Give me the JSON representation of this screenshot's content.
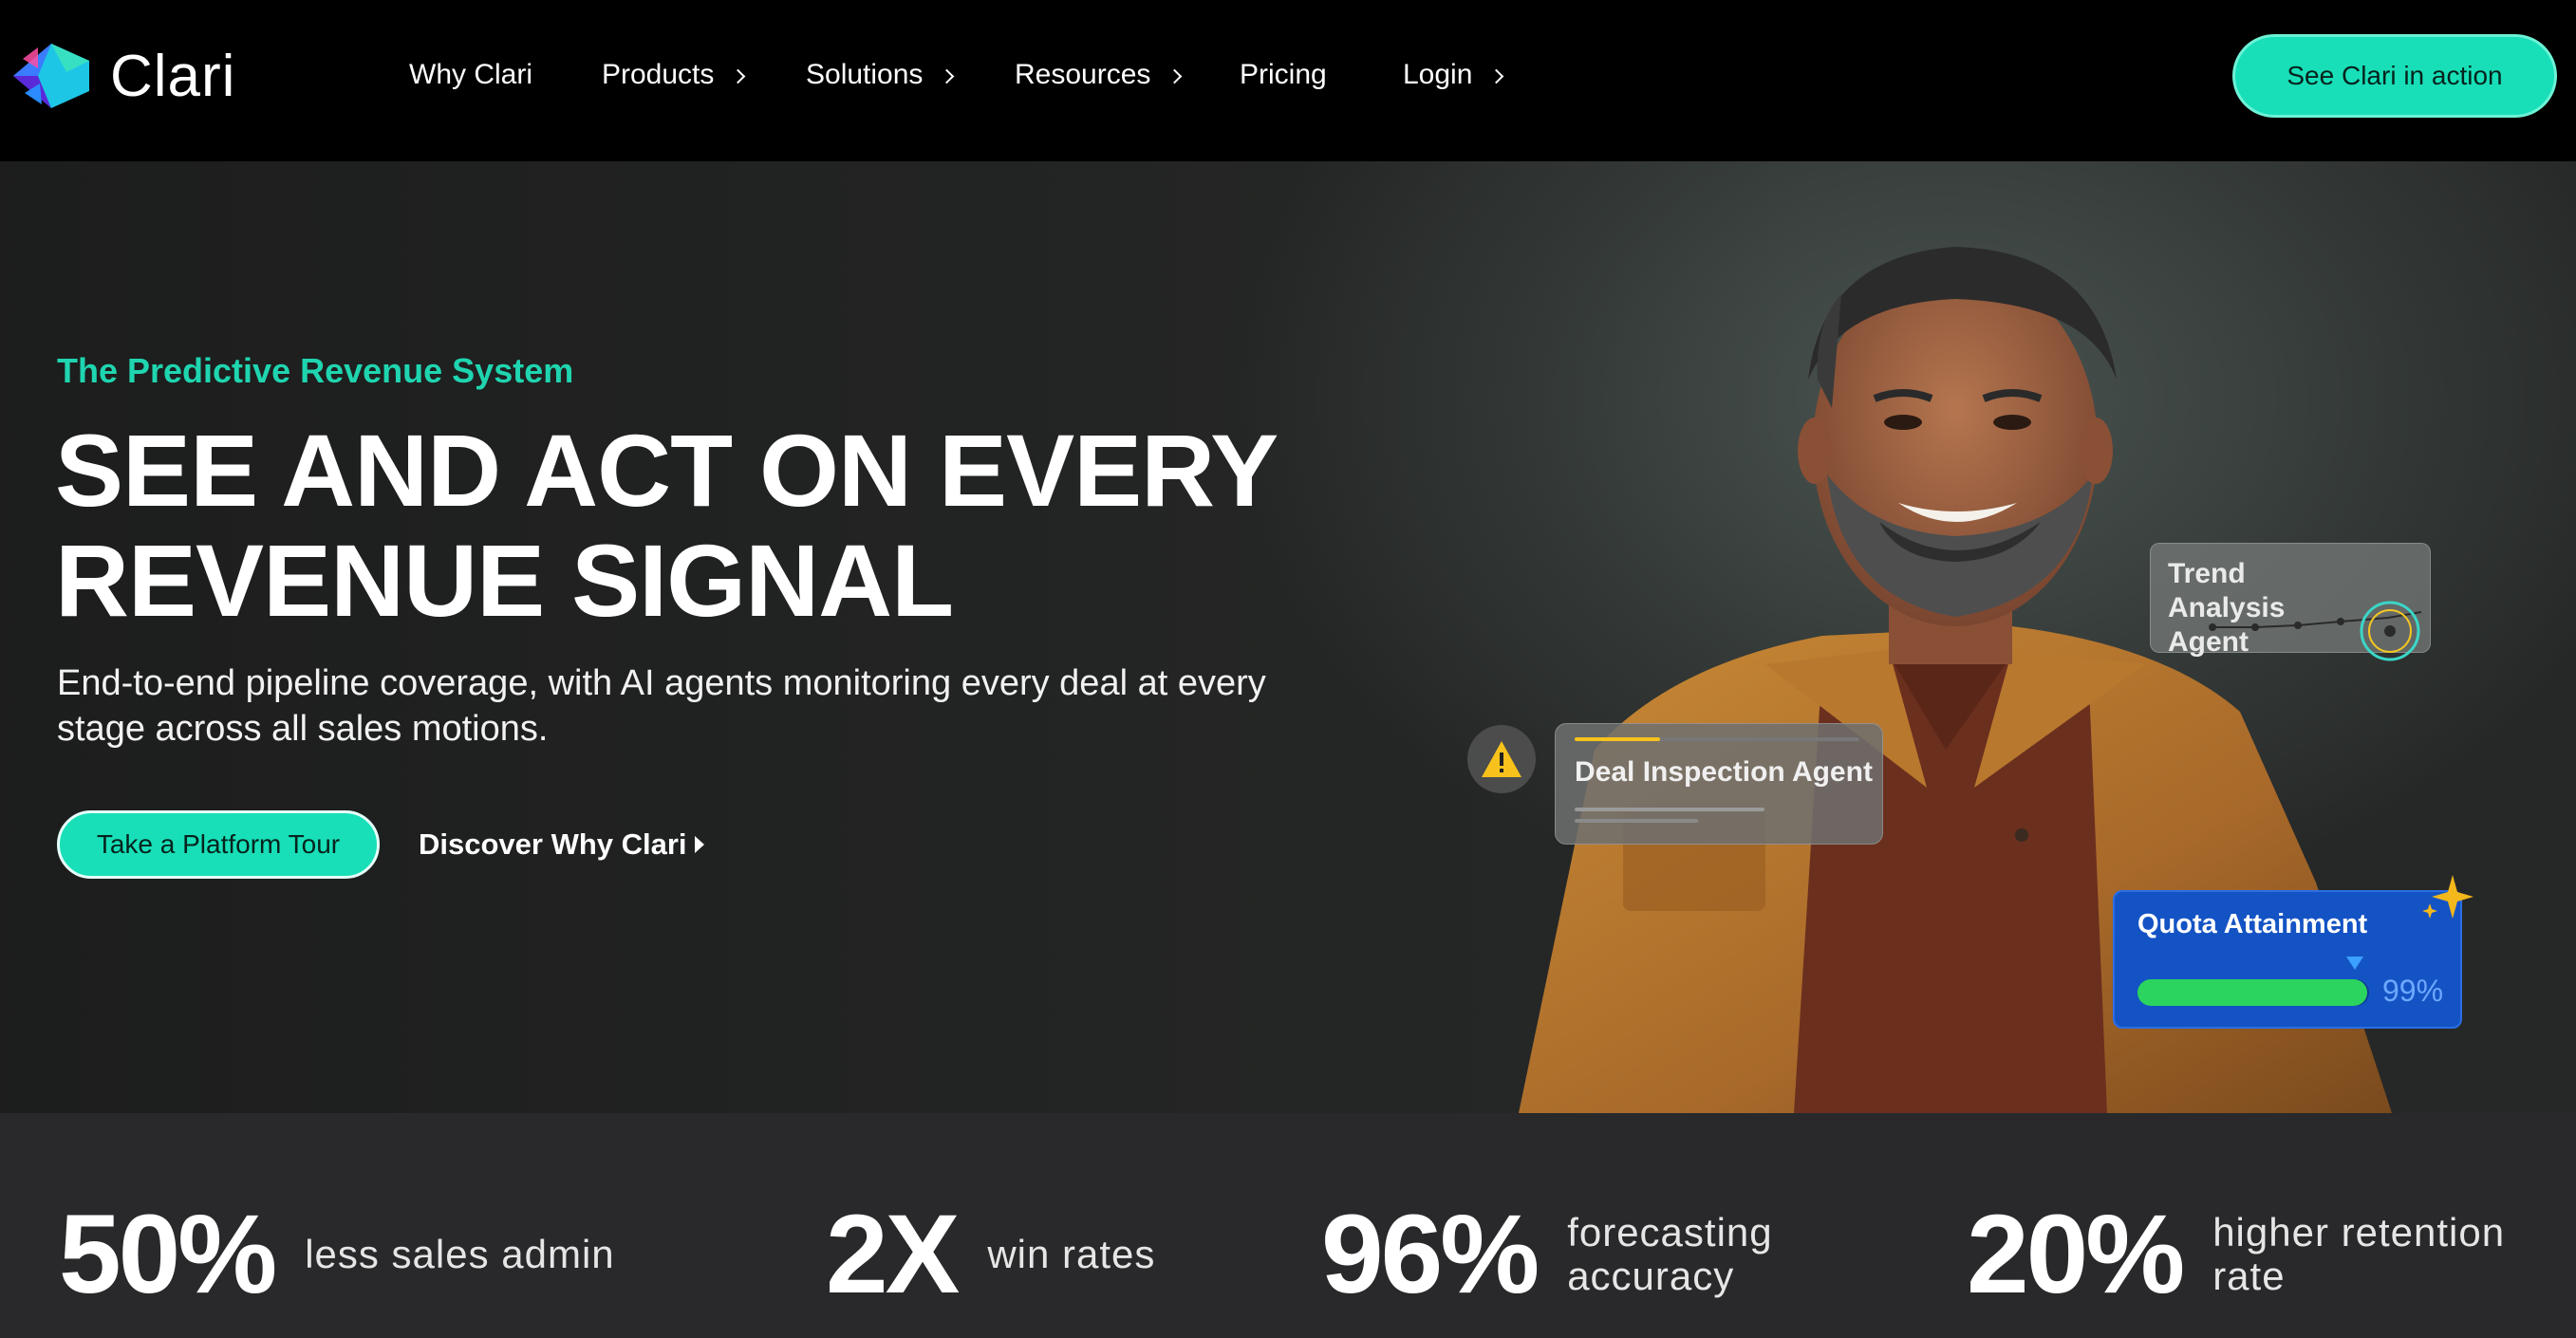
{
  "nav": {
    "logo_text": "Clari",
    "items": [
      {
        "label": "Why Clari",
        "has_chevron": false
      },
      {
        "label": "Products",
        "has_chevron": true
      },
      {
        "label": "Solutions",
        "has_chevron": true
      },
      {
        "label": "Resources",
        "has_chevron": true
      },
      {
        "label": "Pricing",
        "has_chevron": false
      },
      {
        "label": "Login",
        "has_chevron": true
      }
    ],
    "cta_label": "See Clari in action"
  },
  "hero": {
    "eyebrow": "The Predictive Revenue System",
    "headline_line1": "SEE AND ACT ON EVERY",
    "headline_line2": "REVENUE SIGNAL",
    "subline": "End-to-end pipeline coverage, with AI agents monitoring every deal at every stage across all sales motions.",
    "primary_button": "Take a Platform Tour",
    "secondary_link": "Discover Why Clari",
    "cards": {
      "trend_title": "Trend Analysis Agent",
      "deal_title": "Deal Inspection Agent",
      "quota_title": "Quota Attainment",
      "quota_value": "99%",
      "quota_fraction": 0.99
    }
  },
  "stats": [
    {
      "value": "50%",
      "label": "less sales admin"
    },
    {
      "value": "2X",
      "label": "win rates"
    },
    {
      "value": "96%",
      "label": "forecasting accuracy"
    },
    {
      "value": "20%",
      "label": "higher retention rate"
    }
  ],
  "colors": {
    "accent": "#18dfb8",
    "eyebrow": "#1fd5b0",
    "quota_card": "#1453c4",
    "quota_fill": "#2bd45e",
    "warning": "#f7c21c"
  }
}
